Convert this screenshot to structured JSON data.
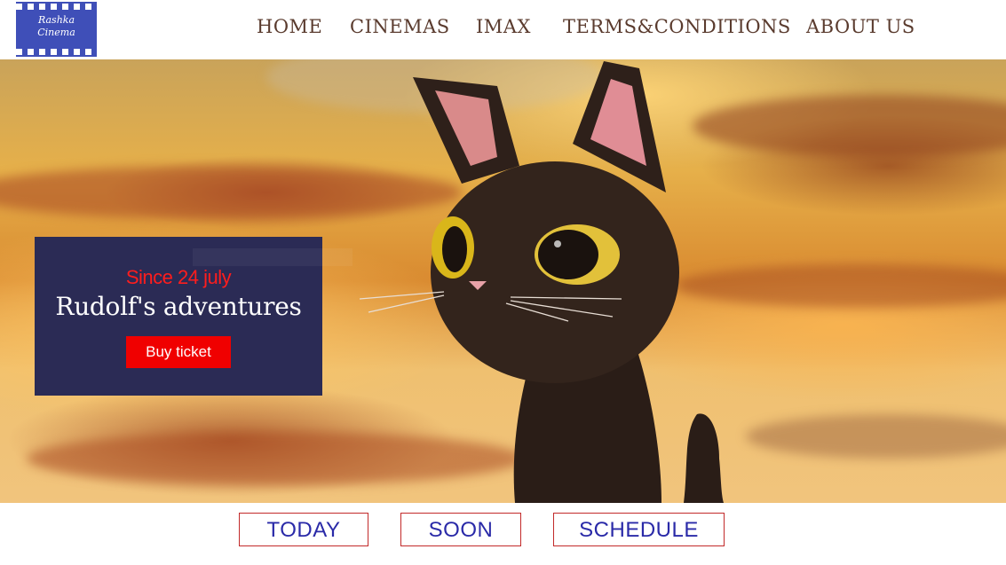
{
  "logo": {
    "line1": "Rashka",
    "line2": "Cinema"
  },
  "nav": {
    "items": [
      {
        "label": "HOME"
      },
      {
        "label": "CINEMAS"
      },
      {
        "label": "IMAX"
      },
      {
        "label": "TERMS&CONDITIONS"
      },
      {
        "label": "ABOUT US"
      }
    ]
  },
  "promo": {
    "since": "Since 24 july",
    "title": "Rudolf's adventures",
    "button": "Buy ticket"
  },
  "tabs": [
    {
      "label": "TODAY"
    },
    {
      "label": "SOON"
    },
    {
      "label": "SCHEDULE"
    }
  ],
  "colors": {
    "nav_text": "#5a3b2e",
    "promo_bg": "#2b2b55",
    "accent_red": "#f00000",
    "tab_text": "#2a2aa8",
    "tab_border": "#c22a2a",
    "logo_bg": "#3f4fb8"
  }
}
